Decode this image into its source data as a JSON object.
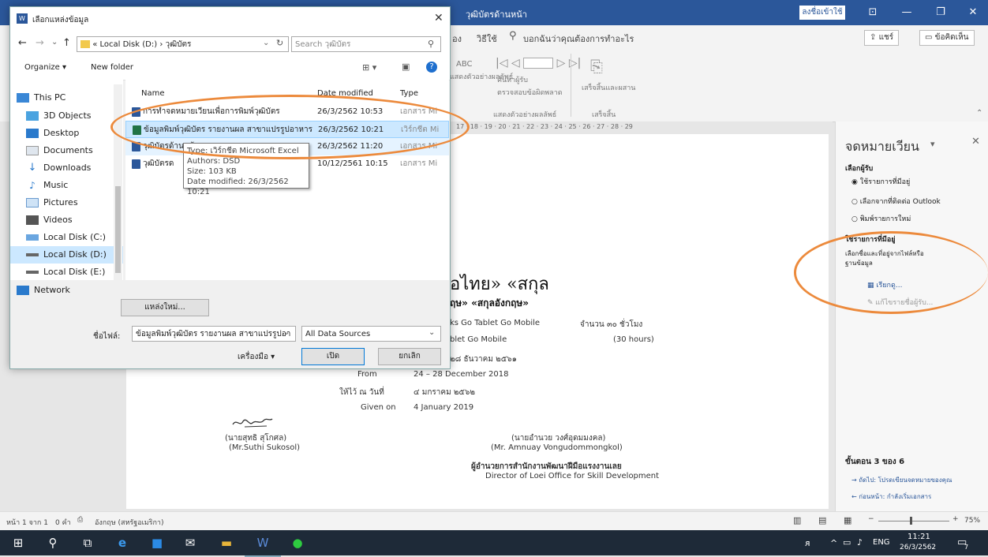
{
  "word": {
    "title": "วุฒิบัตรด้านหน้า",
    "signin": "ลงชื่อเข้าใช้",
    "tabs": [
      "อง",
      "วิธีใช้"
    ],
    "tell_me": "บอกฉันว่าคุณต้องการทำอะไร",
    "share": "แชร์",
    "comments": "ข้อคิดเห็น",
    "ribbon_groups": [
      "แสดงตัวอย่างผลลัพธ์",
      "เสร็จสิ้น"
    ],
    "ribbon_labels": [
      "ABC",
      "แสดงตัวอย่างผลลัพธ์",
      "ค้นหาผู้รับ",
      "ตรวจสอบข้อผิดพลาด",
      "เสร็จสิ้นและผสาน"
    ],
    "ruler_text": "17 · 18 · 19 · 20 · 21 · 22 · 23 · 24 · 25 · 26 · 27 · 28 · 29"
  },
  "document": {
    "heading": "อไทย» «สกุล",
    "subheading": "ฤษ» «สกุลอังกฤษ»",
    "line1": "ks Go Tablet Go Mobile",
    "hours_th": "จำนวน ๓๐ ชั่วโมง",
    "line2": "blet Go Mobile",
    "hours_en": "(30 hours)",
    "date_th_partial": "๒๘ ธันวาคม ๒๕๖๑",
    "from_label": "From",
    "from_value": "24 – 28 December 2018",
    "given_th_label": "ให้ไว้ ณ วันที่",
    "given_th_value": "๔ มกราคม ๒๕๖๒",
    "given_label": "Given on",
    "given_value": "4 January 2019",
    "sig1_name_th": "(นายสุทธิ สุโกศล)",
    "sig1_name_en": "(Mr.Suthi Sukosol)",
    "sig2_name_th": "(นายอำนวย วงศ์อุดมมงคล)",
    "sig2_name_en": "(Mr. Amnuay Vongudommongkol)",
    "sig2_title_th": "ผู้อำนวยการสำนักงานพัฒนาฝีมือแรงงานเลย",
    "sig2_title_en": "Director of Loei Office for Skill Development"
  },
  "pane": {
    "title": "จดหมายเวียน",
    "select_recipients": "เลือกผู้รับ",
    "options": [
      "ใช้รายการที่มีอยู่",
      "เลือกจากที่ติดต่อ Outlook",
      "พิมพ์รายการใหม่"
    ],
    "selected_index": 0,
    "existing_heading": "ใช้รายการที่มีอยู่",
    "existing_desc": "เลือกชื่อและที่อยู่จากไฟล์หรือฐานข้อมูล",
    "browse": "เรียกดู...",
    "edit_list": "แก้ไขรายชื่อผู้รับ...",
    "step": "ขั้นตอน 3 ของ 6",
    "next": "ถัดไป: โปรดเขียนจดหมายของคุณ",
    "prev": "ก่อนหน้า: กำลังเริ่มเอกสาร"
  },
  "status": {
    "page": "หน้า 1 จาก 1",
    "words": "0 คำ",
    "language": "อังกฤษ (สหรัฐอเมริกา)",
    "zoom": "75%"
  },
  "dialog": {
    "title": "เลือกแหล่งข้อมูล",
    "breadcrumb": [
      "Local Disk (D:)",
      "วุฒิบัตร"
    ],
    "search_placeholder": "Search วุฒิบัตร",
    "organize": "Organize ▾",
    "new_folder": "New folder",
    "nav_items": [
      {
        "label": "This PC",
        "icon": "pc-icon"
      },
      {
        "label": "3D Objects",
        "icon": "cube-icon"
      },
      {
        "label": "Desktop",
        "icon": "desktop-icon"
      },
      {
        "label": "Documents",
        "icon": "documents-icon"
      },
      {
        "label": "Downloads",
        "icon": "downloads-icon"
      },
      {
        "label": "Music",
        "icon": "music-icon"
      },
      {
        "label": "Pictures",
        "icon": "pictures-icon"
      },
      {
        "label": "Videos",
        "icon": "videos-icon"
      },
      {
        "label": "Local Disk (C:)",
        "icon": "drive-icon"
      },
      {
        "label": "Local Disk (D:)",
        "icon": "drive-icon"
      },
      {
        "label": "Local Disk (E:)",
        "icon": "drive-icon"
      },
      {
        "label": "Network",
        "icon": "network-icon"
      }
    ],
    "selected_nav_index": 9,
    "columns": [
      "Name",
      "Date modified",
      "Type"
    ],
    "files": [
      {
        "name": "การทำจดหมายเวียนเพื่อการพิมพ์วุฒิบัตร",
        "date": "26/3/2562 10:53",
        "type": "เอกสาร Mi"
      },
      {
        "name": "ข้อมูลพิมพ์วุฒิบัตร รายงานผล สาขาแปรรูปอาหาร",
        "date": "26/3/2562 10:21",
        "type": "เวิร์กชีต Mi"
      },
      {
        "name": "วุฒิบัตรด้านหน้า",
        "date": "26/3/2562 11:20",
        "type": "เอกสาร Mi"
      },
      {
        "name": "วุฒิบัตรด",
        "date": "10/12/2561 10:15",
        "type": "เอกสาร Mi"
      }
    ],
    "selected_file_index": 1,
    "tooltip": {
      "type": "Type: เวิร์กชีต Microsoft Excel",
      "authors": "Authors: DSD",
      "size": "Size: 103 KB",
      "modified": "Date modified: 26/3/2562 10:21"
    },
    "new_source": "แหล่งใหม่...",
    "filename_label": "ชื่อไฟล์:",
    "filename_value": "ข้อมูลพิมพ์วุฒิบัตร รายงานผล สาขาแปรรูปอา",
    "filetype_value": "All Data Sources",
    "tools": "เครื่องมือ",
    "open": "เปิด",
    "cancel": "ยกเลิก"
  },
  "taskbar": {
    "time": "11:21",
    "date": "26/3/2562",
    "lang": "ENG",
    "notifications": "7"
  }
}
